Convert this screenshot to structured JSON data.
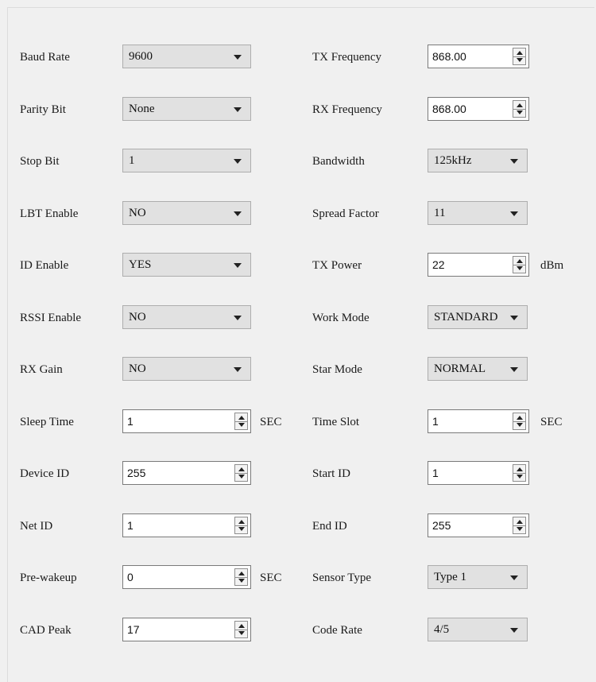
{
  "rows": [
    {
      "left": {
        "label": "Baud Rate",
        "type": "combo",
        "value": "9600"
      },
      "right": {
        "label": "TX Frequency",
        "type": "spin",
        "value": "868.00"
      }
    },
    {
      "left": {
        "label": "Parity Bit",
        "type": "combo",
        "value": "None"
      },
      "right": {
        "label": "RX Frequency",
        "type": "spin",
        "value": "868.00"
      }
    },
    {
      "left": {
        "label": "Stop Bit",
        "type": "combo",
        "value": "1"
      },
      "right": {
        "label": "Bandwidth",
        "type": "combo",
        "value": "125kHz"
      }
    },
    {
      "left": {
        "label": "LBT Enable",
        "type": "combo",
        "value": "NO"
      },
      "right": {
        "label": "Spread Factor",
        "type": "combo",
        "value": "11"
      }
    },
    {
      "left": {
        "label": "ID Enable",
        "type": "combo",
        "value": "YES"
      },
      "right": {
        "label": "TX Power",
        "type": "spin",
        "value": "22",
        "unit": "dBm"
      }
    },
    {
      "left": {
        "label": "RSSI Enable",
        "type": "combo",
        "value": "NO"
      },
      "right": {
        "label": "Work Mode",
        "type": "combo",
        "value": "STANDARD"
      }
    },
    {
      "left": {
        "label": "RX Gain",
        "type": "combo",
        "value": "NO"
      },
      "right": {
        "label": "Star Mode",
        "type": "combo",
        "value": "NORMAL"
      }
    },
    {
      "left": {
        "label": "Sleep Time",
        "type": "spin",
        "value": "1",
        "unit": "SEC"
      },
      "right": {
        "label": "Time Slot",
        "type": "spin",
        "value": "1",
        "unit": "SEC"
      }
    },
    {
      "left": {
        "label": "Device ID",
        "type": "spin",
        "value": "255"
      },
      "right": {
        "label": "Start ID",
        "type": "spin",
        "value": "1"
      }
    },
    {
      "left": {
        "label": "Net ID",
        "type": "spin",
        "value": "1"
      },
      "right": {
        "label": "End ID",
        "type": "spin",
        "value": "255"
      }
    },
    {
      "left": {
        "label": "Pre-wakeup",
        "type": "spin",
        "value": "0",
        "unit": "SEC"
      },
      "right": {
        "label": "Sensor Type",
        "type": "combo",
        "value": "Type 1"
      }
    },
    {
      "left": {
        "label": "CAD Peak",
        "type": "spin",
        "value": "17"
      },
      "right": {
        "label": "Code Rate",
        "type": "combo",
        "value": "4/5"
      }
    }
  ]
}
